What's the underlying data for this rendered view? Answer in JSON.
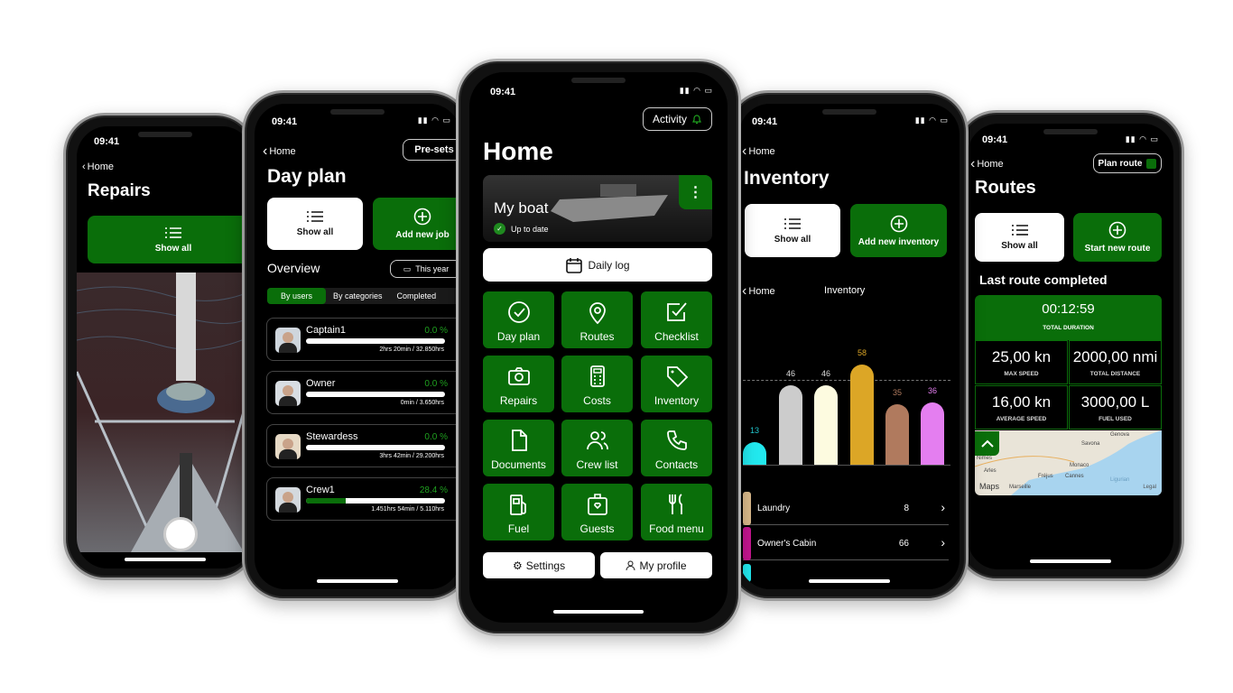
{
  "status_time": "09:41",
  "colors": {
    "brand_green": "#0a6e0a",
    "progress_green": "#1fa01f"
  },
  "repairs": {
    "back_label": "Home",
    "title": "Repairs",
    "show_all_label": "Show all"
  },
  "day_plan": {
    "back_label": "Home",
    "presets_label": "Pre-sets",
    "title": "Day plan",
    "show_all_label": "Show all",
    "add_label": "Add new job",
    "overview_label": "Overview",
    "period_label": "This year",
    "tabs": [
      "By users",
      "By categories",
      "Completed"
    ],
    "active_tab": 0,
    "users": [
      {
        "name": "Captain1",
        "pct": "0.0 %",
        "progress": 0.0,
        "time": "2hrs 20min / 32.850hrs"
      },
      {
        "name": "Owner",
        "pct": "0.0 %",
        "progress": 0.0,
        "time": "0min / 3.650hrs"
      },
      {
        "name": "Stewardess",
        "pct": "0.0 %",
        "progress": 0.0,
        "time": "3hrs 42min / 29.200hrs"
      },
      {
        "name": "Crew1",
        "pct": "28.4 %",
        "progress": 0.284,
        "time": "1.451hrs 54min / 5.110hrs"
      }
    ]
  },
  "home": {
    "activity_label": "Activity",
    "title": "Home",
    "boat_name": "My boat",
    "boat_status": "Up to date",
    "daily_log_label": "Daily log",
    "tiles": [
      {
        "label": "Day plan",
        "icon": "check-circle"
      },
      {
        "label": "Routes",
        "icon": "map-pin"
      },
      {
        "label": "Checklist",
        "icon": "checkbox"
      },
      {
        "label": "Repairs",
        "icon": "camera"
      },
      {
        "label": "Costs",
        "icon": "calculator"
      },
      {
        "label": "Inventory",
        "icon": "tag"
      },
      {
        "label": "Documents",
        "icon": "document"
      },
      {
        "label": "Crew list",
        "icon": "users"
      },
      {
        "label": "Contacts",
        "icon": "phone"
      },
      {
        "label": "Fuel",
        "icon": "fuel-pump"
      },
      {
        "label": "Guests",
        "icon": "guest-badge"
      },
      {
        "label": "Food menu",
        "icon": "fork-knife"
      }
    ],
    "settings_label": "Settings",
    "profile_label": "My profile"
  },
  "inventory": {
    "back_label": "Home",
    "title": "Inventory",
    "show_all_label": "Show all",
    "add_label": "Add new inventory",
    "sub_back_label": "Home",
    "sub_title": "Inventory",
    "chart_data": {
      "type": "bar",
      "values": [
        13,
        46,
        46,
        58,
        35,
        36
      ],
      "colors": [
        "#22e8ee",
        "#cccccc",
        "#fdfbe0",
        "#dca626",
        "#b07a5e",
        "#e47ef0"
      ],
      "label_colors": [
        "#22c8d0",
        "#dddddd",
        "#dddddd",
        "#dca626",
        "#b07a5e",
        "#e47ef0"
      ],
      "ylim": [
        0,
        60
      ]
    },
    "items": [
      {
        "name": "Laundry",
        "count": "8",
        "color": "#d9b98a"
      },
      {
        "name": "Owner's Cabin",
        "count": "66",
        "color": "#c4158f"
      }
    ]
  },
  "routes": {
    "back_label": "Home",
    "plan_label": "Plan route",
    "title": "Routes",
    "show_all_label": "Show all",
    "start_label": "Start new route",
    "last_label": "Last route completed",
    "duration": "00:12:59",
    "duration_label": "TOTAL DURATION",
    "stats": [
      {
        "value": "25,00 kn",
        "label": "MAX SPEED"
      },
      {
        "value": "2000,00 nmi",
        "label": "TOTAL DISTANCE"
      },
      {
        "value": "16,00 kn",
        "label": "AVERAGE SPEED"
      },
      {
        "value": "3000,00 L",
        "label": "FUEL USED"
      }
    ],
    "map_places": [
      "Genova",
      "Savona",
      "Nimes",
      "Arles",
      "Monaco",
      "Fréjus",
      "Cannes",
      "Marseille",
      "Ligurian"
    ],
    "map_brand": "Maps",
    "map_legal": "Legal"
  }
}
